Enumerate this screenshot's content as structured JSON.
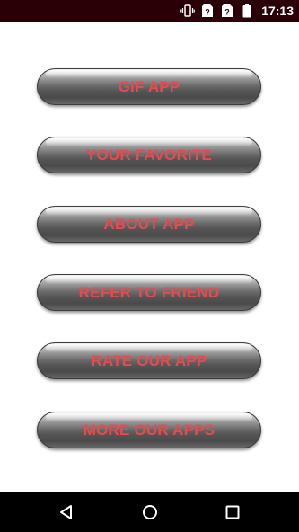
{
  "status_bar": {
    "time": "17:13",
    "icons": [
      "vibrate-icon",
      "sim-unknown-icon",
      "sim-unknown-icon",
      "battery-icon"
    ]
  },
  "menu": {
    "buttons": [
      {
        "label": "GIF APP"
      },
      {
        "label": "YOUR FAVORITE"
      },
      {
        "label": "ABOUT APP"
      },
      {
        "label": "REFER TO FRIEND"
      },
      {
        "label": "RATE OUR APP"
      },
      {
        "label": "MORE OUR APPS"
      }
    ]
  },
  "nav_bar": {
    "icons": [
      "back-icon",
      "home-icon",
      "recents-icon"
    ]
  },
  "colors": {
    "status_bar_bg": "#2a0006",
    "button_text": "#e84a4f",
    "nav_bar_bg": "#000000",
    "background": "#ffffff"
  }
}
